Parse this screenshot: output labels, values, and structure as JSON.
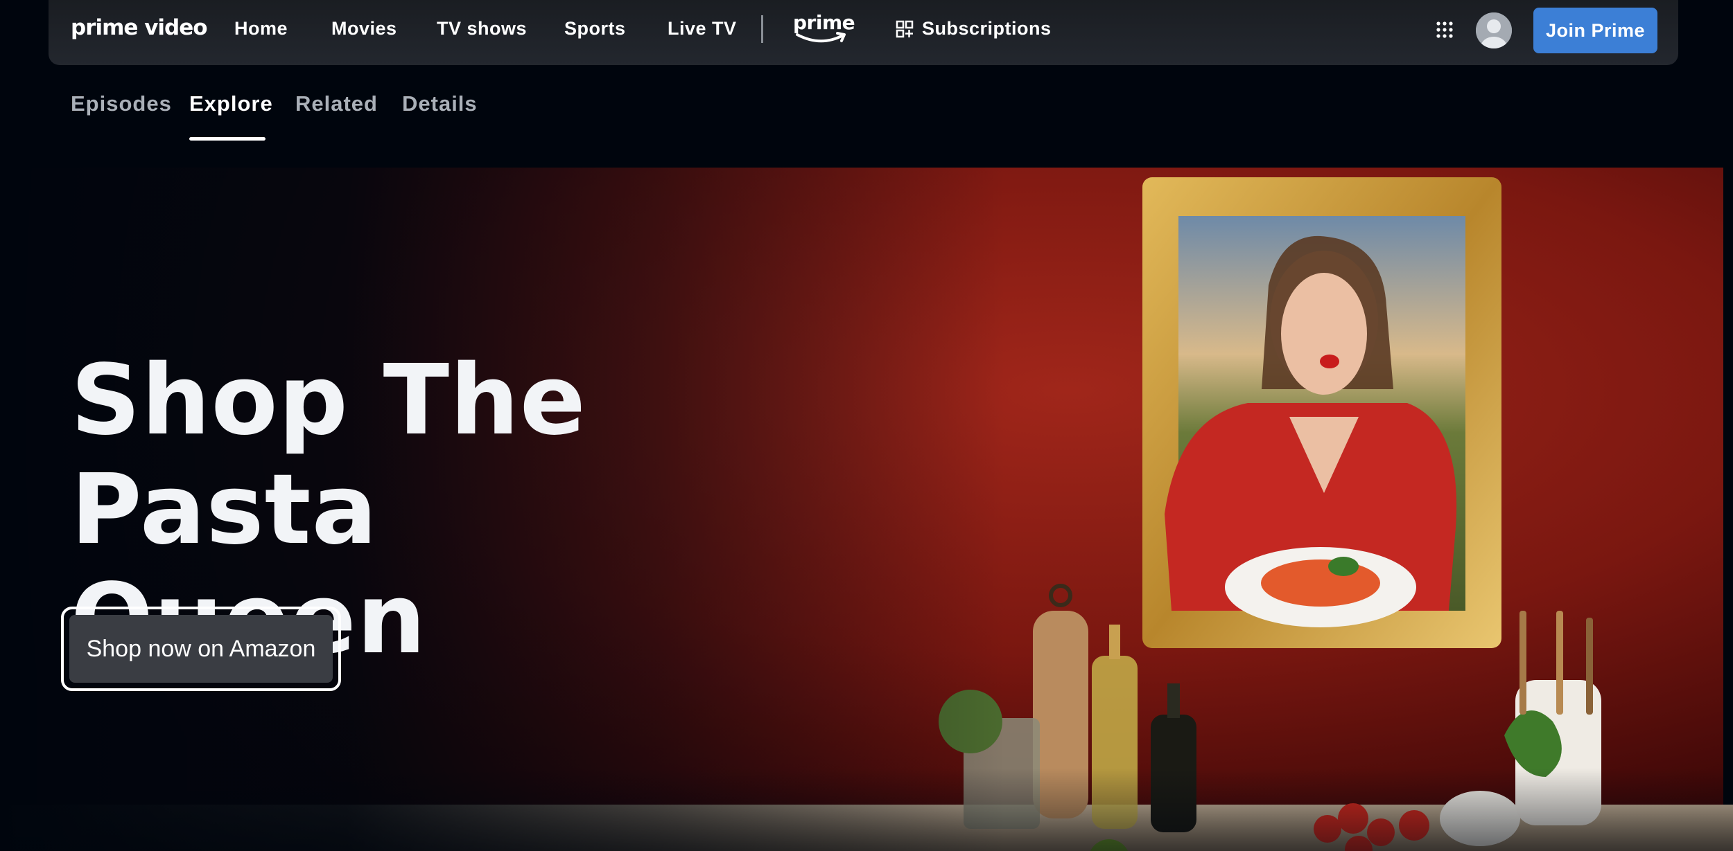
{
  "app": {
    "logo_text": "prime video",
    "prime_badge": "prime"
  },
  "nav": {
    "items": [
      {
        "label": "Home"
      },
      {
        "label": "Movies"
      },
      {
        "label": "TV shows"
      },
      {
        "label": "Sports"
      },
      {
        "label": "Live TV"
      }
    ],
    "subscriptions_label": "Subscriptions",
    "join_label": "Join Prime"
  },
  "tabs": [
    {
      "label": "Episodes",
      "active": false
    },
    {
      "label": "Explore",
      "active": true
    },
    {
      "label": "Related",
      "active": false
    },
    {
      "label": "Details",
      "active": false
    }
  ],
  "hero": {
    "title_line1": "Shop The Pasta",
    "title_line2": "Queen",
    "cta_label": "Shop now on Amazon"
  },
  "colors": {
    "accent_blue": "#3c7fd6",
    "background": "#00050d",
    "hero_red": "#8a1c12"
  },
  "icons": [
    "apps-grid-icon",
    "avatar-icon",
    "subscriptions-icon",
    "prime-smile-icon"
  ]
}
